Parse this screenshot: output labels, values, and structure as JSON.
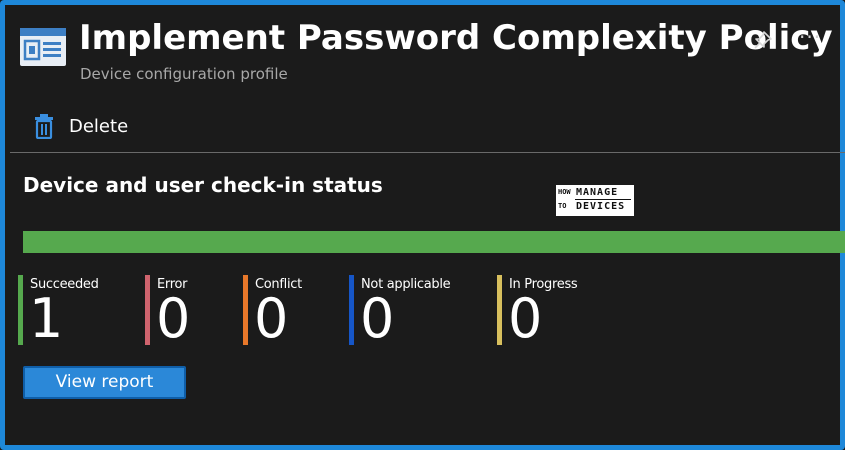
{
  "header": {
    "title": "Implement Password Complexity Policy",
    "subtitle": "Device configuration profile",
    "icon": "device-config-profile-icon",
    "pin_icon": "pin-icon",
    "more_label": "···"
  },
  "toolbar": {
    "delete_label": "Delete",
    "delete_icon": "trash-icon"
  },
  "status_section": {
    "title": "Device and user check-in status",
    "progress_fraction": 1.0,
    "progress_color": "#56a94e",
    "stats": [
      {
        "label": "Succeeded",
        "value": "1",
        "color": "#56a94e"
      },
      {
        "label": "Error",
        "value": "0",
        "color": "#d0646e"
      },
      {
        "label": "Conflict",
        "value": "0",
        "color": "#e8782a"
      },
      {
        "label": "Not applicable",
        "value": "0",
        "color": "#1656c8"
      },
      {
        "label": "In Progress",
        "value": "0",
        "color": "#d8c05e"
      }
    ],
    "view_report_label": "View report"
  },
  "watermark": {
    "line1": "HOW",
    "line2": "TO",
    "line3": "MANAGE",
    "line4": "DEVICES"
  },
  "colors": {
    "accent": "#2b88d8",
    "frame": "#1e88d9",
    "background": "#1b1b1b"
  }
}
